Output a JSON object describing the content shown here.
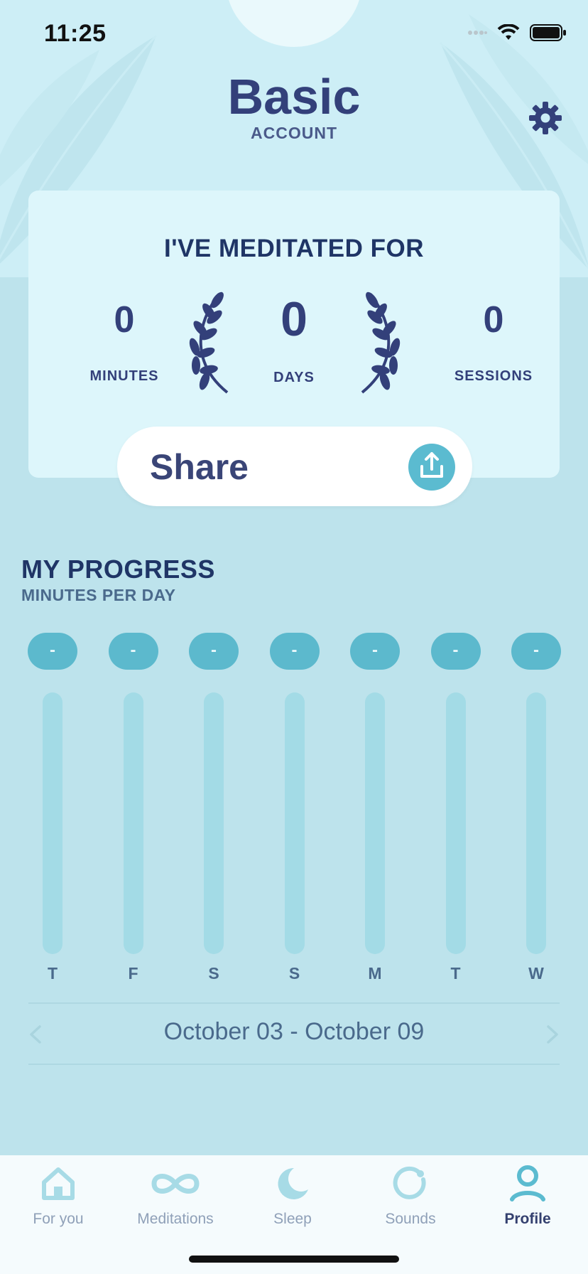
{
  "status_bar": {
    "time": "11:25"
  },
  "header": {
    "title": "Basic",
    "subtitle": "ACCOUNT"
  },
  "stats": {
    "title": "I'VE MEDITATED FOR",
    "minutes": {
      "value": "0",
      "label": "MINUTES"
    },
    "days": {
      "value": "0",
      "label": "DAYS"
    },
    "sessions": {
      "value": "0",
      "label": "SESSIONS"
    }
  },
  "share": {
    "label": "Share"
  },
  "progress": {
    "title": "MY PROGRESS",
    "subtitle": "MINUTES PER DAY",
    "days": [
      {
        "label": "T",
        "value": "-"
      },
      {
        "label": "F",
        "value": "-"
      },
      {
        "label": "S",
        "value": "-"
      },
      {
        "label": "S",
        "value": "-"
      },
      {
        "label": "M",
        "value": "-"
      },
      {
        "label": "T",
        "value": "-"
      },
      {
        "label": "W",
        "value": "-"
      }
    ],
    "date_range": "October 03 - October 09"
  },
  "tabs": [
    {
      "label": "For you",
      "icon": "home-icon"
    },
    {
      "label": "Meditations",
      "icon": "infinity-icon"
    },
    {
      "label": "Sleep",
      "icon": "moon-icon"
    },
    {
      "label": "Sounds",
      "icon": "sounds-icon"
    },
    {
      "label": "Profile",
      "icon": "profile-icon",
      "active": true
    }
  ],
  "colors": {
    "background": "#bde3ec",
    "hero": "#cdeef6",
    "card": "#ddf6fb",
    "accent": "#5bbbd0",
    "navy": "#33407a"
  }
}
